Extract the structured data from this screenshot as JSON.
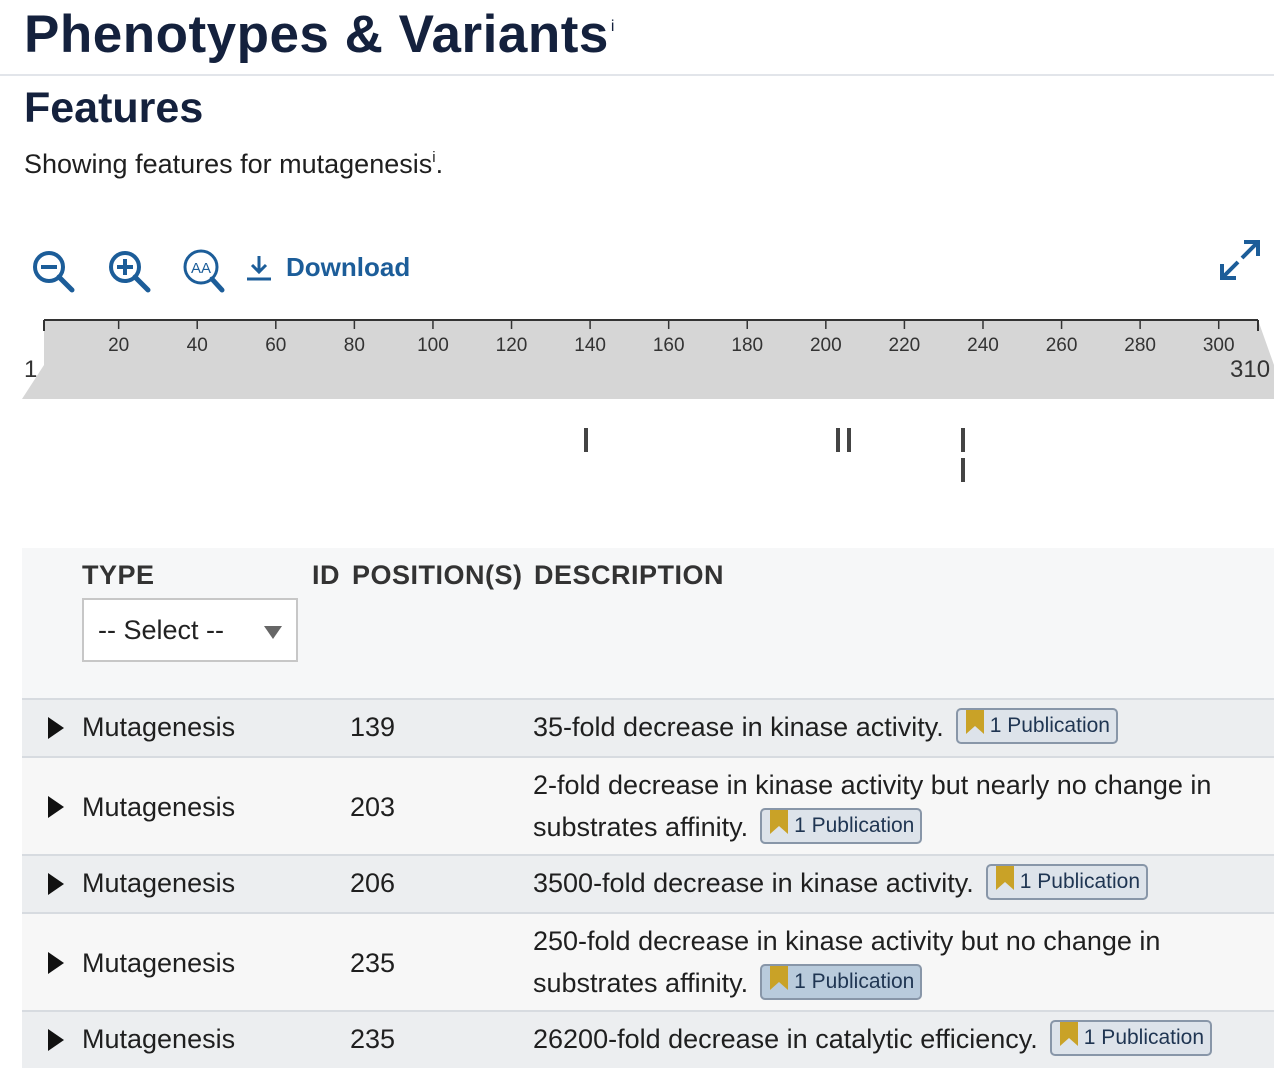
{
  "page": {
    "title": "Phenotypes & Variants",
    "title_info": "i",
    "section": "Features",
    "subtitle_prefix": "Showing features for mutagenesis",
    "subtitle_info": "i",
    "subtitle_suffix": "."
  },
  "toolbar": {
    "zoom_out_icon": "zoom-out-icon",
    "zoom_in_icon": "zoom-in-icon",
    "aa_zoom_icon": "sequence-zoom-icon",
    "aa_label": "AA",
    "download_label": "Download",
    "download_icon": "download-icon",
    "fullscreen_icon": "fullscreen-icon"
  },
  "ruler": {
    "start": 1,
    "end": 310,
    "start_label": "1",
    "end_label": "310",
    "ticks": [
      "20",
      "40",
      "60",
      "80",
      "100",
      "120",
      "140",
      "160",
      "180",
      "200",
      "220",
      "240",
      "260",
      "280",
      "300"
    ]
  },
  "track": {
    "features": [
      {
        "position": 139,
        "lane": 0
      },
      {
        "position": 203,
        "lane": 0
      },
      {
        "position": 206,
        "lane": 0
      },
      {
        "position": 235,
        "lane": 0
      },
      {
        "position": 235,
        "lane": 1
      }
    ]
  },
  "table": {
    "headers": {
      "type": "TYPE",
      "id": "ID",
      "positions": "POSITION(S)",
      "description": "DESCRIPTION"
    },
    "type_filter": "-- Select --",
    "rows": [
      {
        "type": "Mutagenesis",
        "position": "139",
        "description": "35-fold decrease in kinase activity.",
        "publication": "1 Publication"
      },
      {
        "type": "Mutagenesis",
        "position": "203",
        "description": "2-fold decrease in kinase activity but nearly no change in substrates affinity.",
        "publication": "1 Publication"
      },
      {
        "type": "Mutagenesis",
        "position": "206",
        "description": "3500-fold decrease in kinase activity.",
        "publication": "1 Publication"
      },
      {
        "type": "Mutagenesis",
        "position": "235",
        "description": "250-fold decrease in kinase activity but no change in substrates affinity.",
        "publication": "1 Publication"
      },
      {
        "type": "Mutagenesis",
        "position": "235",
        "description": "26200-fold decrease in catalytic efficiency.",
        "publication": "1 Publication"
      }
    ]
  },
  "colors": {
    "heading": "#14213d",
    "link": "#1c5d99",
    "bookmark": "#c9a227",
    "badge_bg": "#dde3ea",
    "ruler_fill": "#d6d6d6"
  }
}
